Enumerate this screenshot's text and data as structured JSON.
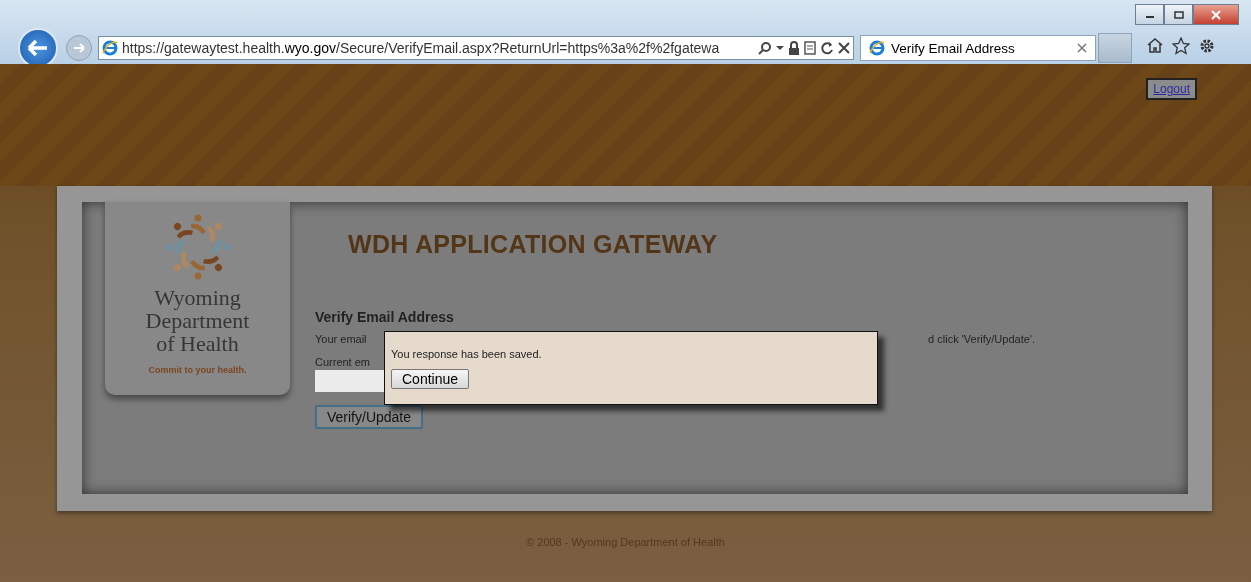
{
  "browser": {
    "url_prefix": "https://gatewaytest.health.",
    "url_domain": "wyo.gov",
    "url_rest": "/Secure/VerifyEmail.aspx?ReturnUrl=https%3a%2f%2fgatewa",
    "tab_title": "Verify Email Address"
  },
  "logout": "Logout",
  "logo": {
    "line1": "Wyoming",
    "line2": "Department",
    "line3": "of Health",
    "tagline": "Commit to your health."
  },
  "title": "WDH APPLICATION GATEWAY",
  "form": {
    "heading": "Verify Email Address",
    "intro_start": "Your email",
    "intro_end": "d click 'Verify/Update'.",
    "current_label": "Current em",
    "button": "Verify/Update"
  },
  "dialog": {
    "message": "You response has been saved.",
    "button": "Continue"
  },
  "footer": "© 2008 - Wyoming Department of Health"
}
